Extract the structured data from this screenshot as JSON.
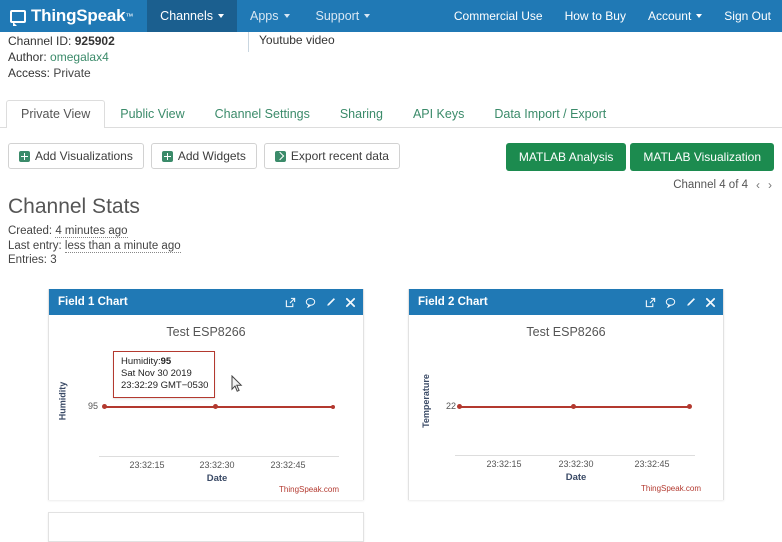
{
  "topnav": {
    "brand": "ThingSpeak",
    "brand_tm": "™",
    "items": [
      {
        "label": "Channels",
        "active": true
      },
      {
        "label": "Apps",
        "active": false
      },
      {
        "label": "Support",
        "active": false
      }
    ],
    "right_items": [
      {
        "label": "Commercial Use"
      },
      {
        "label": "How to Buy"
      },
      {
        "label": "Account"
      },
      {
        "label": "Sign Out"
      }
    ],
    "bg_color": "#2079b5",
    "active_bg_color": "#1b5f8f"
  },
  "channel_info": {
    "channel_id_label": "Channel ID:",
    "channel_id_value": "925902",
    "author_label": "Author:",
    "author_value": "omegalax4",
    "access_label": "Access:",
    "access_value": "Private",
    "youtube_video": "Youtube video"
  },
  "tabs": [
    {
      "label": "Private View",
      "active": true
    },
    {
      "label": "Public View",
      "active": false
    },
    {
      "label": "Channel Settings",
      "active": false
    },
    {
      "label": "Sharing",
      "active": false
    },
    {
      "label": "API Keys",
      "active": false
    },
    {
      "label": "Data Import / Export",
      "active": false
    }
  ],
  "actions": {
    "add_visualizations": "Add Visualizations",
    "add_widgets": "Add Widgets",
    "export_recent_data": "Export recent data",
    "matlab_analysis": "MATLAB Analysis",
    "matlab_visualization": "MATLAB Visualization",
    "green_color": "#1c8b4f"
  },
  "pager": {
    "text": "Channel 4 of 4",
    "prev": "‹",
    "next": "›"
  },
  "channel_stats": {
    "title": "Channel Stats",
    "created_label": "Created:",
    "created_value": "4 minutes ago",
    "last_entry_label": "Last entry:",
    "last_entry_value": "less than a minute ago",
    "entries_label": "Entries:",
    "entries_value": "3"
  },
  "widgets": [
    {
      "title": "Field 1 Chart",
      "icons": [
        "popout-icon",
        "comment-icon",
        "pencil-icon",
        "close-icon"
      ]
    },
    {
      "title": "Field 2 Chart",
      "icons": [
        "popout-icon",
        "comment-icon",
        "pencil-icon",
        "close-icon"
      ]
    }
  ],
  "tooltip": {
    "line1_label": "Humidity:",
    "line1_value": "95",
    "line2": "Sat Nov 30 2019",
    "line3": "23:32:29 GMT−0530"
  },
  "chart_data": [
    {
      "type": "line",
      "title": "Test ESP8266",
      "xlabel": "Date",
      "ylabel": "Humidity",
      "series": [
        {
          "name": "Humidity",
          "values": [
            95,
            95,
            95
          ],
          "color": "#b3392f"
        }
      ],
      "x": [
        "23:32:29",
        "23:32:31",
        "23:32:52"
      ],
      "xtick_labels": [
        "23:32:15",
        "23:32:30",
        "23:32:45"
      ],
      "ytick_labels": [
        "95"
      ],
      "ylim": [
        95,
        95
      ],
      "grid": false,
      "legend": "none",
      "credit": "ThingSpeak.com"
    },
    {
      "type": "line",
      "title": "Test ESP8266",
      "xlabel": "Date",
      "ylabel": "Temperature",
      "series": [
        {
          "name": "Temperature",
          "values": [
            22,
            22,
            22
          ],
          "color": "#b3392f"
        }
      ],
      "x": [
        "23:32:29",
        "23:32:31",
        "23:32:52"
      ],
      "xtick_labels": [
        "23:32:15",
        "23:32:30",
        "23:32:45"
      ],
      "ytick_labels": [
        "22"
      ],
      "ylim": [
        22,
        22
      ],
      "grid": false,
      "legend": "none",
      "credit": "ThingSpeak.com"
    }
  ]
}
